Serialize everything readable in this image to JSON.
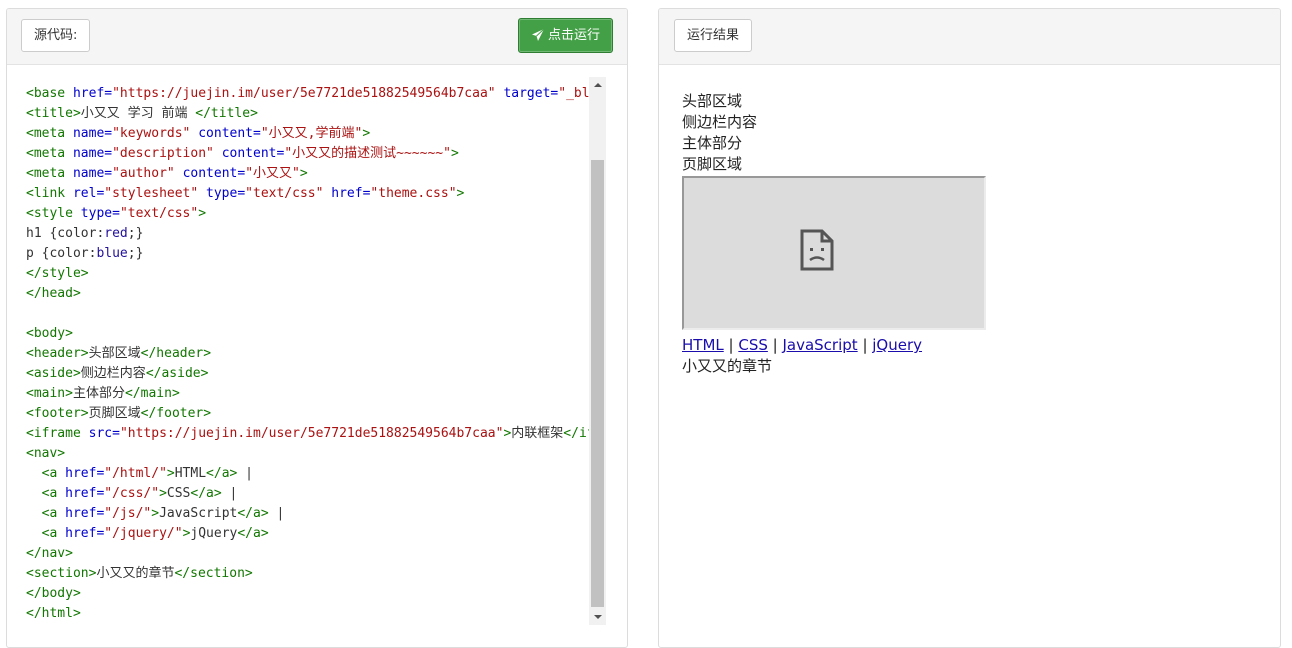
{
  "source_panel": {
    "label": "源代码:",
    "run_button": "点击运行",
    "code_lines": [
      [
        [
          "t",
          "<base "
        ],
        [
          "a",
          "href="
        ],
        [
          "v",
          "\"https://juejin.im/user/5e7721de51882549564b7caa\""
        ],
        [
          "k",
          " "
        ],
        [
          "a",
          "target="
        ],
        [
          "v",
          "\"_blank\""
        ],
        [
          "t",
          ">"
        ]
      ],
      [
        [
          "t",
          "<title>"
        ],
        [
          "k",
          "小又又 学习 前端 "
        ],
        [
          "t",
          "</title>"
        ]
      ],
      [
        [
          "t",
          "<meta "
        ],
        [
          "a",
          "name="
        ],
        [
          "v",
          "\"keywords\""
        ],
        [
          "k",
          " "
        ],
        [
          "a",
          "content="
        ],
        [
          "v",
          "\"小又又,学前端\""
        ],
        [
          "t",
          ">"
        ]
      ],
      [
        [
          "t",
          "<meta "
        ],
        [
          "a",
          "name="
        ],
        [
          "v",
          "\"description\""
        ],
        [
          "k",
          " "
        ],
        [
          "a",
          "content="
        ],
        [
          "v",
          "\"小又又的描述测试~~~~~~\""
        ],
        [
          "t",
          ">"
        ]
      ],
      [
        [
          "t",
          "<meta "
        ],
        [
          "a",
          "name="
        ],
        [
          "v",
          "\"author\""
        ],
        [
          "k",
          " "
        ],
        [
          "a",
          "content="
        ],
        [
          "v",
          "\"小又又\""
        ],
        [
          "t",
          ">"
        ]
      ],
      [
        [
          "t",
          "<link "
        ],
        [
          "a",
          "rel="
        ],
        [
          "v",
          "\"stylesheet\""
        ],
        [
          "k",
          " "
        ],
        [
          "a",
          "type="
        ],
        [
          "v",
          "\"text/css\""
        ],
        [
          "k",
          " "
        ],
        [
          "a",
          "href="
        ],
        [
          "v",
          "\"theme.css\""
        ],
        [
          "t",
          ">"
        ]
      ],
      [
        [
          "t",
          "<style "
        ],
        [
          "a",
          "type="
        ],
        [
          "v",
          "\"text/css\""
        ],
        [
          "t",
          ">"
        ]
      ],
      [
        [
          "k",
          "h1 {color:"
        ],
        [
          "cv",
          "red"
        ],
        [
          "k",
          ";}"
        ]
      ],
      [
        [
          "k",
          "p {color:"
        ],
        [
          "cv",
          "blue"
        ],
        [
          "k",
          ";}"
        ]
      ],
      [
        [
          "t",
          "</style>"
        ]
      ],
      [
        [
          "t",
          "</head>"
        ]
      ],
      [],
      [
        [
          "t",
          "<body>"
        ]
      ],
      [
        [
          "t",
          "<header>"
        ],
        [
          "k",
          "头部区域"
        ],
        [
          "t",
          "</header>"
        ]
      ],
      [
        [
          "t",
          "<aside>"
        ],
        [
          "k",
          "侧边栏内容"
        ],
        [
          "t",
          "</aside>"
        ]
      ],
      [
        [
          "t",
          "<main>"
        ],
        [
          "k",
          "主体部分"
        ],
        [
          "t",
          "</main>"
        ]
      ],
      [
        [
          "t",
          "<footer>"
        ],
        [
          "k",
          "页脚区域"
        ],
        [
          "t",
          "</footer>"
        ]
      ],
      [
        [
          "t",
          "<iframe "
        ],
        [
          "a",
          "src="
        ],
        [
          "v",
          "\"https://juejin.im/user/5e7721de51882549564b7caa\""
        ],
        [
          "t",
          ">"
        ],
        [
          "k",
          "内联框架"
        ],
        [
          "t",
          "</iframe>"
        ]
      ],
      [
        [
          "t",
          "<nav>"
        ]
      ],
      [
        [
          "k",
          "  "
        ],
        [
          "t",
          "<a "
        ],
        [
          "a",
          "href="
        ],
        [
          "v",
          "\"/html/\""
        ],
        [
          "t",
          ">"
        ],
        [
          "k",
          "HTML"
        ],
        [
          "t",
          "</a>"
        ],
        [
          "k",
          " |"
        ]
      ],
      [
        [
          "k",
          "  "
        ],
        [
          "t",
          "<a "
        ],
        [
          "a",
          "href="
        ],
        [
          "v",
          "\"/css/\""
        ],
        [
          "t",
          ">"
        ],
        [
          "k",
          "CSS"
        ],
        [
          "t",
          "</a>"
        ],
        [
          "k",
          " |"
        ]
      ],
      [
        [
          "k",
          "  "
        ],
        [
          "t",
          "<a "
        ],
        [
          "a",
          "href="
        ],
        [
          "v",
          "\"/js/\""
        ],
        [
          "t",
          ">"
        ],
        [
          "k",
          "JavaScript"
        ],
        [
          "t",
          "</a>"
        ],
        [
          "k",
          " |"
        ]
      ],
      [
        [
          "k",
          "  "
        ],
        [
          "t",
          "<a "
        ],
        [
          "a",
          "href="
        ],
        [
          "v",
          "\"/jquery/\""
        ],
        [
          "t",
          ">"
        ],
        [
          "k",
          "jQuery"
        ],
        [
          "t",
          "</a>"
        ]
      ],
      [
        [
          "t",
          "</nav>"
        ]
      ],
      [
        [
          "t",
          "<section>"
        ],
        [
          "k",
          "小又又的章节"
        ],
        [
          "t",
          "</section>"
        ]
      ],
      [
        [
          "t",
          "</body>"
        ]
      ],
      [
        [
          "t",
          "</html>"
        ]
      ]
    ]
  },
  "result_panel": {
    "label": "运行结果",
    "header_text": "头部区域",
    "aside_text": "侧边栏内容",
    "main_text": "主体部分",
    "footer_text": "页脚区域",
    "nav_links": [
      {
        "text": "HTML",
        "href": "/html/"
      },
      {
        "text": "CSS",
        "href": "/css/"
      },
      {
        "text": "JavaScript",
        "href": "/js/"
      },
      {
        "text": "jQuery",
        "href": "/jquery/"
      }
    ],
    "nav_separator": " | ",
    "section_text": "小又又的章节",
    "iframe_icon": "broken-page-icon"
  },
  "colors": {
    "tag": "#117700",
    "attribute": "#0000cc",
    "string": "#aa1111",
    "css_value": "#221199",
    "run_button": "#43a047"
  }
}
